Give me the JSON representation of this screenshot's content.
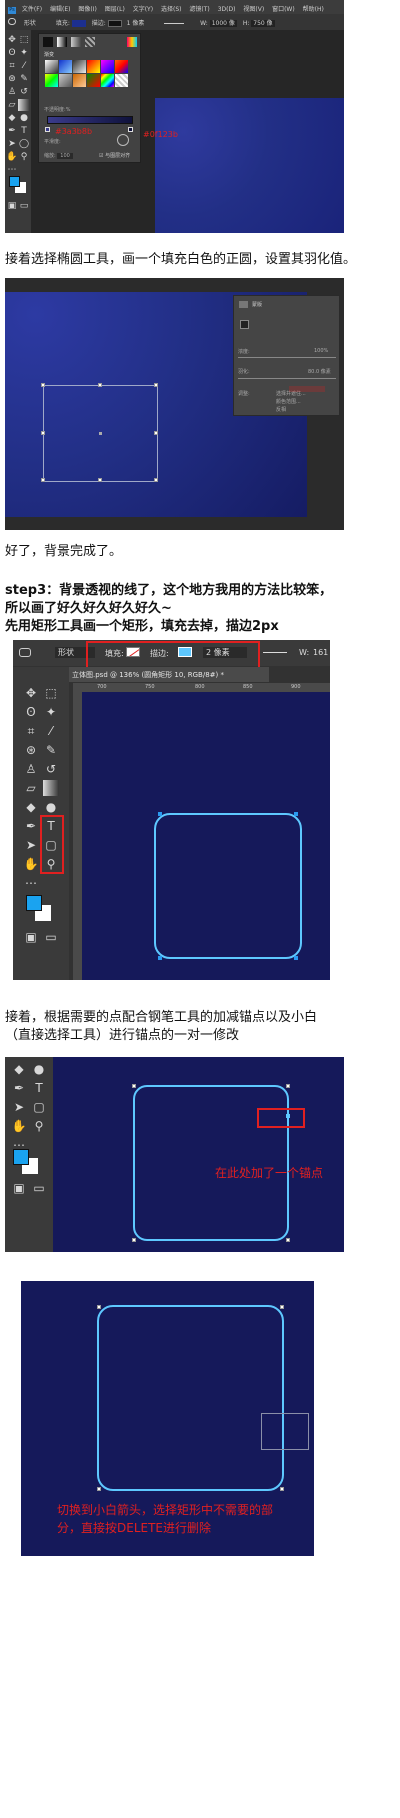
{
  "shot1": {
    "menu": [
      "文件(F)",
      "编辑(E)",
      "图像(I)",
      "图层(L)",
      "文字(Y)",
      "选择(S)",
      "滤镜(T)",
      "3D(D)",
      "视图(V)",
      "窗口(W)",
      "帮助(H)"
    ],
    "shape_mode": "形状",
    "fill_label": "填充:",
    "stroke_label": "描边:",
    "stroke_size": "1 像素",
    "w_label": "W:",
    "w_value": "1000 像",
    "h_label": "H:",
    "h_value": "750 像",
    "picker_section": "渐变",
    "picker_title": "渐变",
    "smoothness_label": "平滑度:",
    "opacity_hint": "%",
    "scale_label": "缩放:",
    "scale_value": "100",
    "align_label": "与图层对齐",
    "color_start": "#3a3b8b",
    "color_end": "#0f123b"
  },
  "caption1": "接着选择椭圆工具，画一个填充白色的正圆，设置其羽化值。",
  "shot2": {
    "panel_label": "蒙版",
    "density_label": "浓度:",
    "density_value": "100%",
    "feather_label": "羽化:",
    "feather_value": "80.0 像素",
    "refine_label": "调整:",
    "select_focus": "选择并遮住...",
    "color_range": "颜色范围...",
    "invert": "反相"
  },
  "caption2": "好了，背景完成了。",
  "caption3": {
    "line1": "step3：背景透视的线了，这个地方我用的方法比较笨，",
    "line2": "所以画了好久好久好久好久~",
    "line3": "先用矩形工具画一个矩形，填充去掉，描边2px"
  },
  "shot3": {
    "shape_mode": "形状",
    "fill_label": "填充:",
    "stroke_label": "描边:",
    "stroke_value": "2 像素",
    "w_label": "W:",
    "w_value": "161",
    "tab_title": "立体图.psd @ 136% (圆角矩形 10, RGB/8#) *",
    "ruler_marks": [
      "700",
      "750",
      "800",
      "850",
      "900"
    ]
  },
  "caption4": {
    "line1": "接着，根据需要的点配合钢笔工具的加减锚点以及小白",
    "line2": "（直接选择工具）进行锚点的一对一修改"
  },
  "shot4": {
    "annotation": "在此处加了一个锚点"
  },
  "shot5": {
    "annotation_line1": "切换到小白箭头，选择矩形中不需要的部",
    "annotation_line2": "分，直接按DELETE进行删除"
  }
}
